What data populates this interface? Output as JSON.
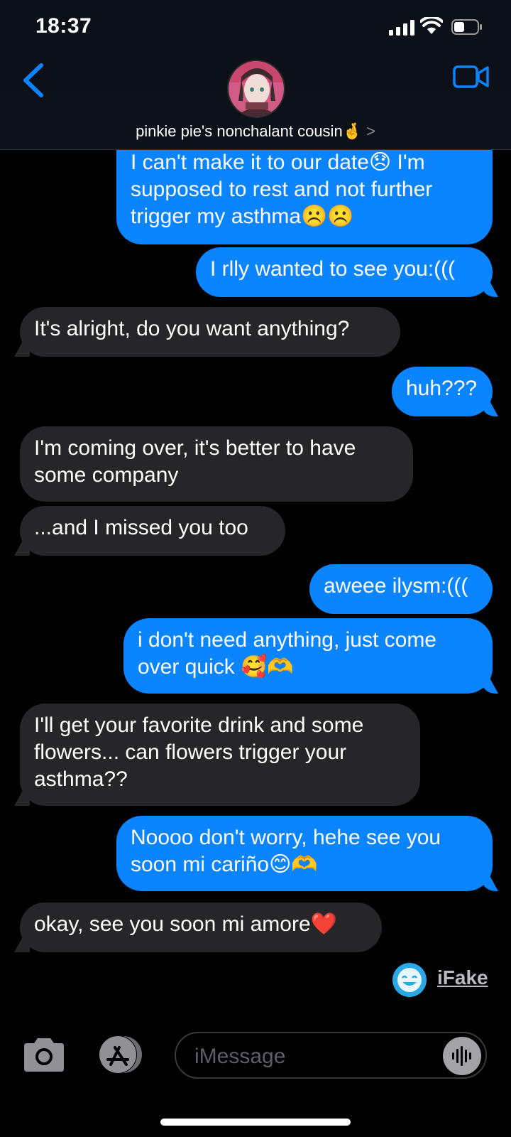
{
  "status_bar": {
    "time": "18:37"
  },
  "header": {
    "contact_name": "pinkie pie's nonchalant cousin🤞",
    "chevron": ">"
  },
  "messages": [
    {
      "dir": "out",
      "text": "I can't make it to our date😞 I'm supposed to rest and not further trigger my asthma☹️☹️"
    },
    {
      "dir": "out",
      "text": "I rlly wanted to see you:((("
    },
    {
      "dir": "in",
      "text": "It's alright, do you want anything?"
    },
    {
      "dir": "out",
      "text": "huh???"
    },
    {
      "dir": "in",
      "text": "I'm coming over, it's better to have some company"
    },
    {
      "dir": "in",
      "text": "...and I missed you too"
    },
    {
      "dir": "out",
      "text": "aweee ilysm:((("
    },
    {
      "dir": "out",
      "text": "i don't need anything, just come over quick 🥰🫶"
    },
    {
      "dir": "in",
      "text": "I'll get your favorite drink and some flowers... can flowers trigger your asthma??"
    },
    {
      "dir": "out",
      "text": "Noooo don't worry, hehe see you soon mi cariño😊🫶"
    },
    {
      "dir": "in",
      "text": "okay, see you soon mi amore❤️"
    }
  ],
  "watermark": {
    "text": "iFake"
  },
  "composer": {
    "placeholder": "iMessage"
  },
  "colors": {
    "outgoing_bubble": "#0a84ff",
    "incoming_bubble": "#262628",
    "accent": "#0a84ff",
    "background": "#000000"
  },
  "icons": {
    "back": "chevron-left-icon",
    "video": "video-camera-icon",
    "camera": "camera-icon",
    "apps": "app-store-icon",
    "audio": "waveform-icon"
  }
}
